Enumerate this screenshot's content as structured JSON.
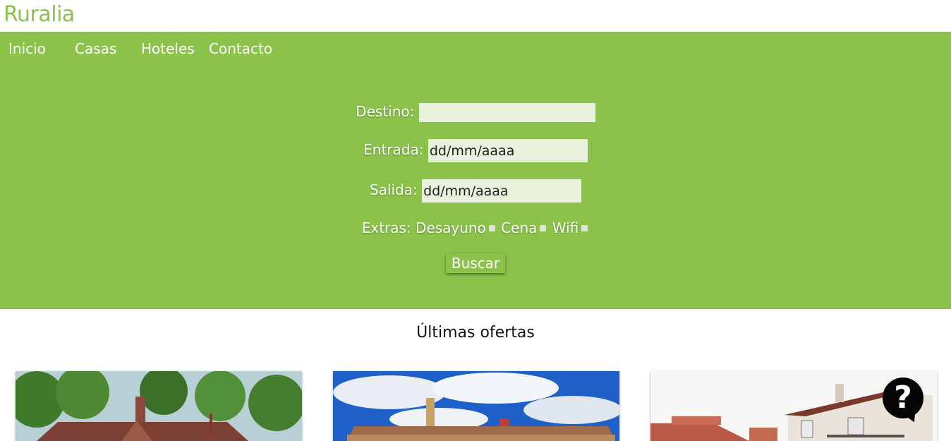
{
  "brand": "Ruralia",
  "nav": [
    "Inicio",
    "Casas",
    "Hoteles",
    "Contacto"
  ],
  "search": {
    "destino_label": "Destino:",
    "destino_value": "",
    "entrada_label": "Entrada:",
    "entrada_value": "dd/mm/aaaa",
    "salida_label": "Salida:",
    "salida_value": "dd/mm/aaaa",
    "extras_label": "Extras:",
    "extras": [
      "Desayuno",
      "Cena",
      "Wifi"
    ],
    "submit": "Buscar"
  },
  "offers_title": "Últimas ofertas",
  "help_icon": "question-mark-icon",
  "colors": {
    "primary": "#8bc34a",
    "input_bg": "#e8f2dc"
  }
}
